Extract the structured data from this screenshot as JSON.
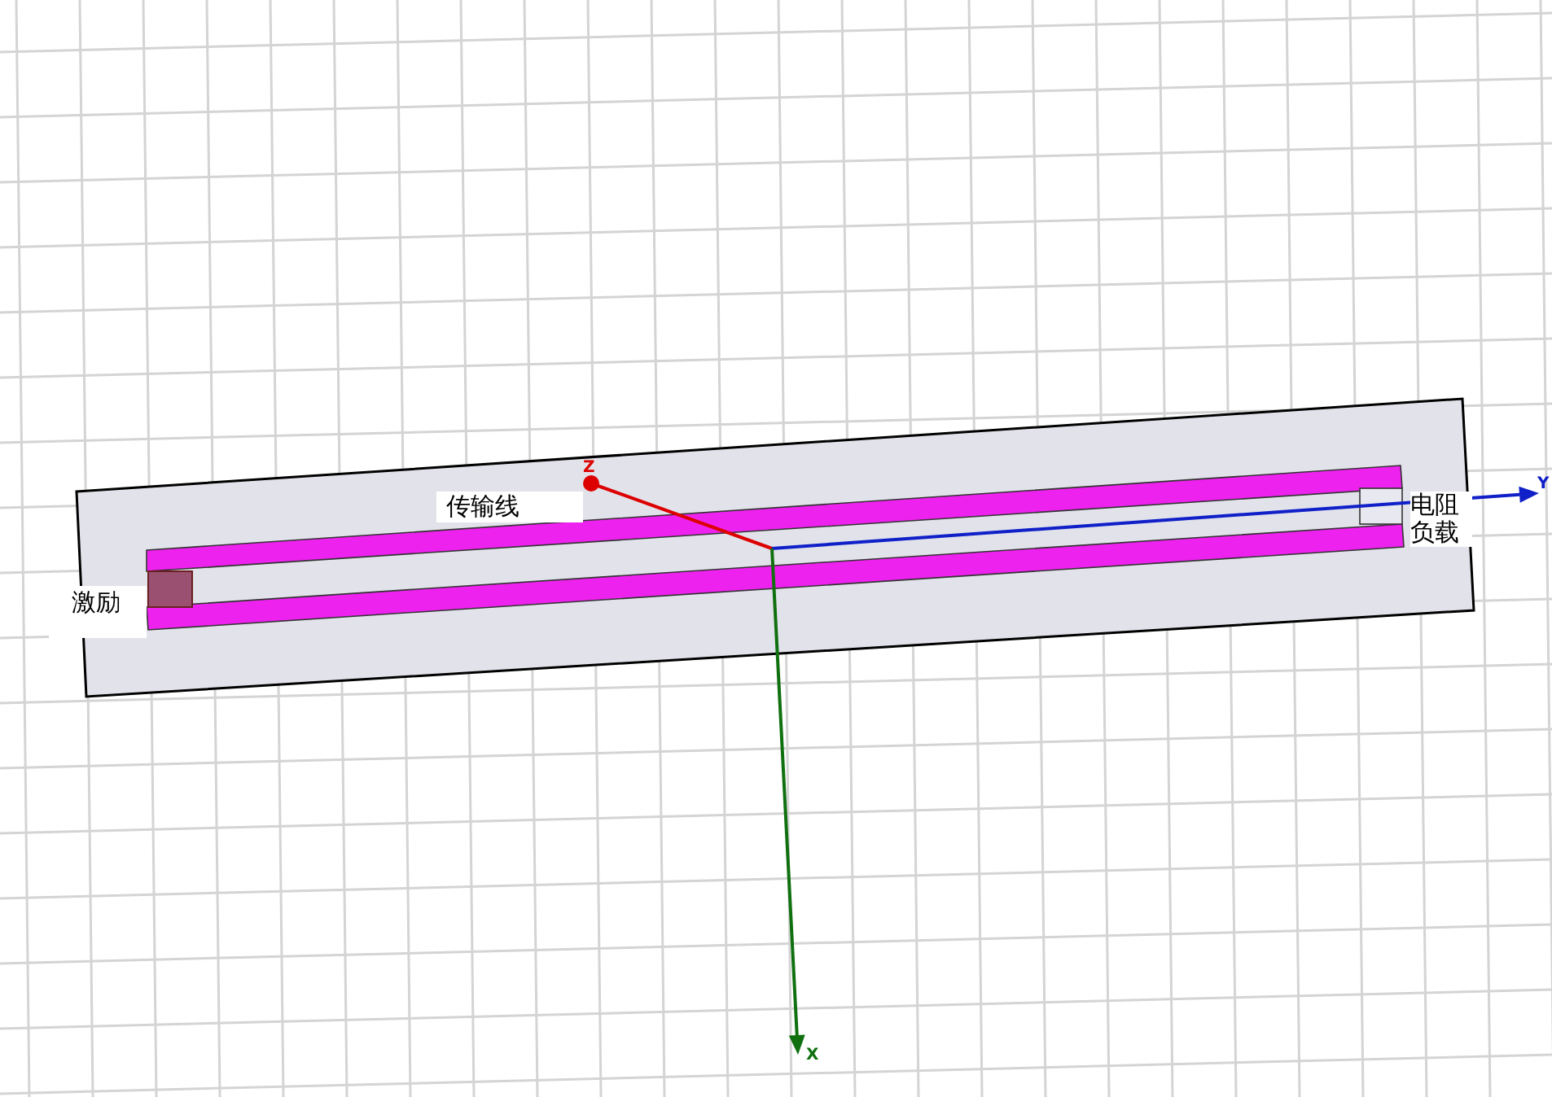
{
  "labels": {
    "transmission_line": "传输线",
    "excitation": "激励",
    "load": [
      "电阻",
      "负载"
    ]
  },
  "axes": [
    {
      "label": "Z",
      "color": "#dd0000"
    },
    {
      "label": "Y",
      "color": "#1020c8"
    },
    {
      "label": "X",
      "color": "#107010"
    }
  ]
}
